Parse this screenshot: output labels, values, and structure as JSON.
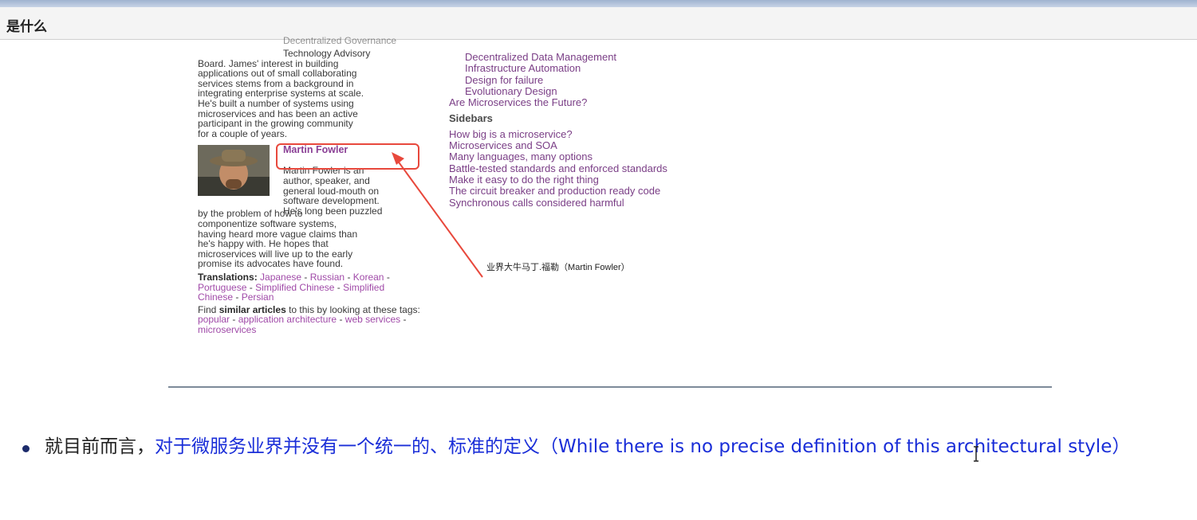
{
  "header": {
    "title": "是什么"
  },
  "screenshot": {
    "clipped_heading": "Decentralized Governance",
    "left": {
      "bio_lines": [
        "Technology Advisory",
        "Board. James' interest in building",
        "applications out of small collaborating",
        "services stems from a background in",
        "integrating enterprise systems at scale.",
        "He's built a number of systems using",
        "microservices and has been an active",
        "participant in the growing community",
        "for a couple of years."
      ],
      "author_name": "Martin Fowler",
      "author_bio_top": [
        "Martin Fowler is an",
        "author, speaker, and",
        "general loud-mouth on",
        "software development.",
        "He's long been puzzled"
      ],
      "author_bio_rest": [
        "by the problem of how to",
        "componentize software systems,",
        "having heard more vague claims than",
        "he's happy with. He hopes that",
        "microservices will live up to the early",
        "promise its advocates have found."
      ],
      "translations_label": "Translations:",
      "translations": [
        "Japanese",
        "Russian",
        "Korean",
        "Portuguese",
        "Simplified Chinese",
        "Simplified Chinese",
        "Persian"
      ],
      "find_prefix": "Find ",
      "find_bold": "similar articles",
      "find_suffix": " to this by looking at these tags:",
      "tags": [
        "popular",
        "application architecture",
        "web services",
        "microservices"
      ]
    },
    "right": {
      "toc_sub": [
        "Decentralized Data Management",
        "Infrastructure Automation",
        "Design for failure",
        "Evolutionary Design"
      ],
      "toc_main": "Are Microservices the Future?",
      "sidebars_heading": "Sidebars",
      "sidebars": [
        "How big is a microservice?",
        "Microservices and SOA",
        "Many languages, many options",
        "Battle-tested standards and enforced standards",
        "Make it easy to do the right thing",
        "The circuit breaker and production ready code",
        "Synchronous calls considered harmful"
      ]
    },
    "annotation": "业界大牛马丁.福勒（Martin Fowler）"
  },
  "bullet": {
    "prefix": "就目前而言，",
    "blue_text": "对于微服务业界并没有一个统一的、标准的定义（While there is no precise definition of this architectural style）"
  },
  "colors": {
    "link": "#a04aa8",
    "highlight": "#e8483c",
    "bullet_blue": "#1a2ed8"
  }
}
